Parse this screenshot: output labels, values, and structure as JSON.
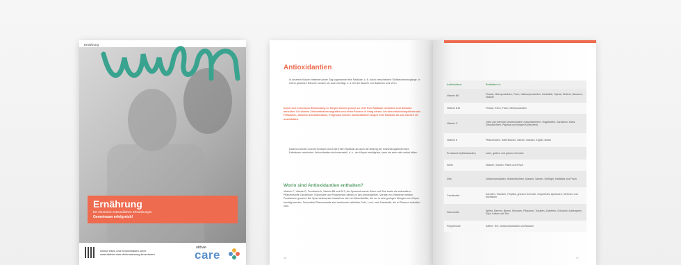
{
  "cover": {
    "section_label": "Ernährung",
    "title": "Ernährung",
    "subtitle": "bei chronisch entzündlichen Erkrankungen",
    "slogan": "Gemeinsam erfolgreich!",
    "footer_line1": "Online lesen und herunterladen unter",
    "footer_line2": "www.abbvie-care.de/ernaehrung-broschuere",
    "logo_brand": "abbvie",
    "logo_care": "care",
    "accent_color": "#ee6b4f",
    "scribble_color": "#3aa38f"
  },
  "left_page": {
    "heading": "Antioxidantien",
    "para1": "In unserem Körper entstehen jeden Tag sogenannte freie Radikale, z. B. durch verschiedene Stoffwechselvorgänge. In einem gewissen Rahmen werden sie auch benötigt, u. a. bei der Abwehr von Bakterien und Viren.",
    "para2": "Durch eine chronische Entzündung im Körper können jedoch zu viele freie Radikale entstehen und Schaden anrichten. Sie können Zellmembranen angreifen und einen Prozess in Gang setzen, bei dem entzündungsfördernde Fettsäuren, darunter Arachidonsäure, freigesetzt werden. Antioxidantien fangen freie Radikale ab und machen sie unschädlich.",
    "para3": "Dadurch werden sowohl Schäden durch die freien Radikale als auch die Bildung der entzündungsfördernden Fettsäuren vermindert. Antioxidantien sind essenziell, d. h., der Körper benötigt sie, kann sie aber nicht selbst bilden.",
    "subheading": "Worin sind Antioxidantien enthalten?",
    "para4": "Vitamin C, Vitamin E, Provitamin A, Vitamin B6 und B12, die Spurenelemente Selen und Zink sowie die sekundären Pflanzenstoffe Carotinoide, Flavonoide und Polyphenole zählen zu den Antioxidantien. Vorräte von Vitaminen werden Provitamine genannt. Bei Spurenelementen handelt es sich um Mineralstoffe, die nur in sehr geringen Mengen vom Körper benötigt werden. Sekundäre Pflanzenstoffe sind bestimmte natürliche Duft-, Lock- oder Farbstoffe, die in Pflanzen enthalten sind.",
    "page_number": "16"
  },
  "right_page": {
    "table": {
      "headers": [
        "Antioxidans:",
        "Enthalten in:"
      ],
      "rows": [
        [
          "Vitamin B6",
          "Fleisch, Milchprodukten, Fisch, Vollkornprodukten, Kartoffeln, Spinat, Sellerie, Bananen, Nüssen"
        ],
        [
          "Vitamin B12",
          "Fleisch, Eiern, Fisch, Milchprodukten"
        ],
        [
          "Vitamin C",
          "Obst und Gemüse (insbesondere Johannisbeeren, Hagebutten, Sanddorn, Kiwis, Zitrusfrüchten, Paprika und einigen Kohlsorten)"
        ],
        [
          "Vitamin E",
          "Pflanzenölen, Haferflocken, Samen, Nüssen, Eigelb, Butter"
        ],
        [
          "Provitamin A (Betacarotin)",
          "roten, gelben und grünen Gemüse"
        ],
        [
          "Selen",
          "Nüssen, Samen, Pilzen und Fisch"
        ],
        [
          "Zink",
          "Vollkornprodukten, Hülsenfrüchten, Nüssen, Samen, Geflügel, Hartkäse und Fisch"
        ],
        [
          "Carotinoide",
          "Karotten, Tomaten, Paprika, grünem Gemüse, Grapefruits, Aprikosen, Melonen und Kürbissen"
        ],
        [
          "Flavonoide",
          "Äpfeln, Beeren, Birnen, Kirschen, Pflaumen, Trauben, Zwiebeln, Grünkohl, Auberginen, Soja, Kakao und Tee"
        ],
        [
          "Polyphenole",
          "Kaffee, Tee, Vollkornprodukten und Nüssen"
        ]
      ]
    },
    "page_number": "17"
  }
}
